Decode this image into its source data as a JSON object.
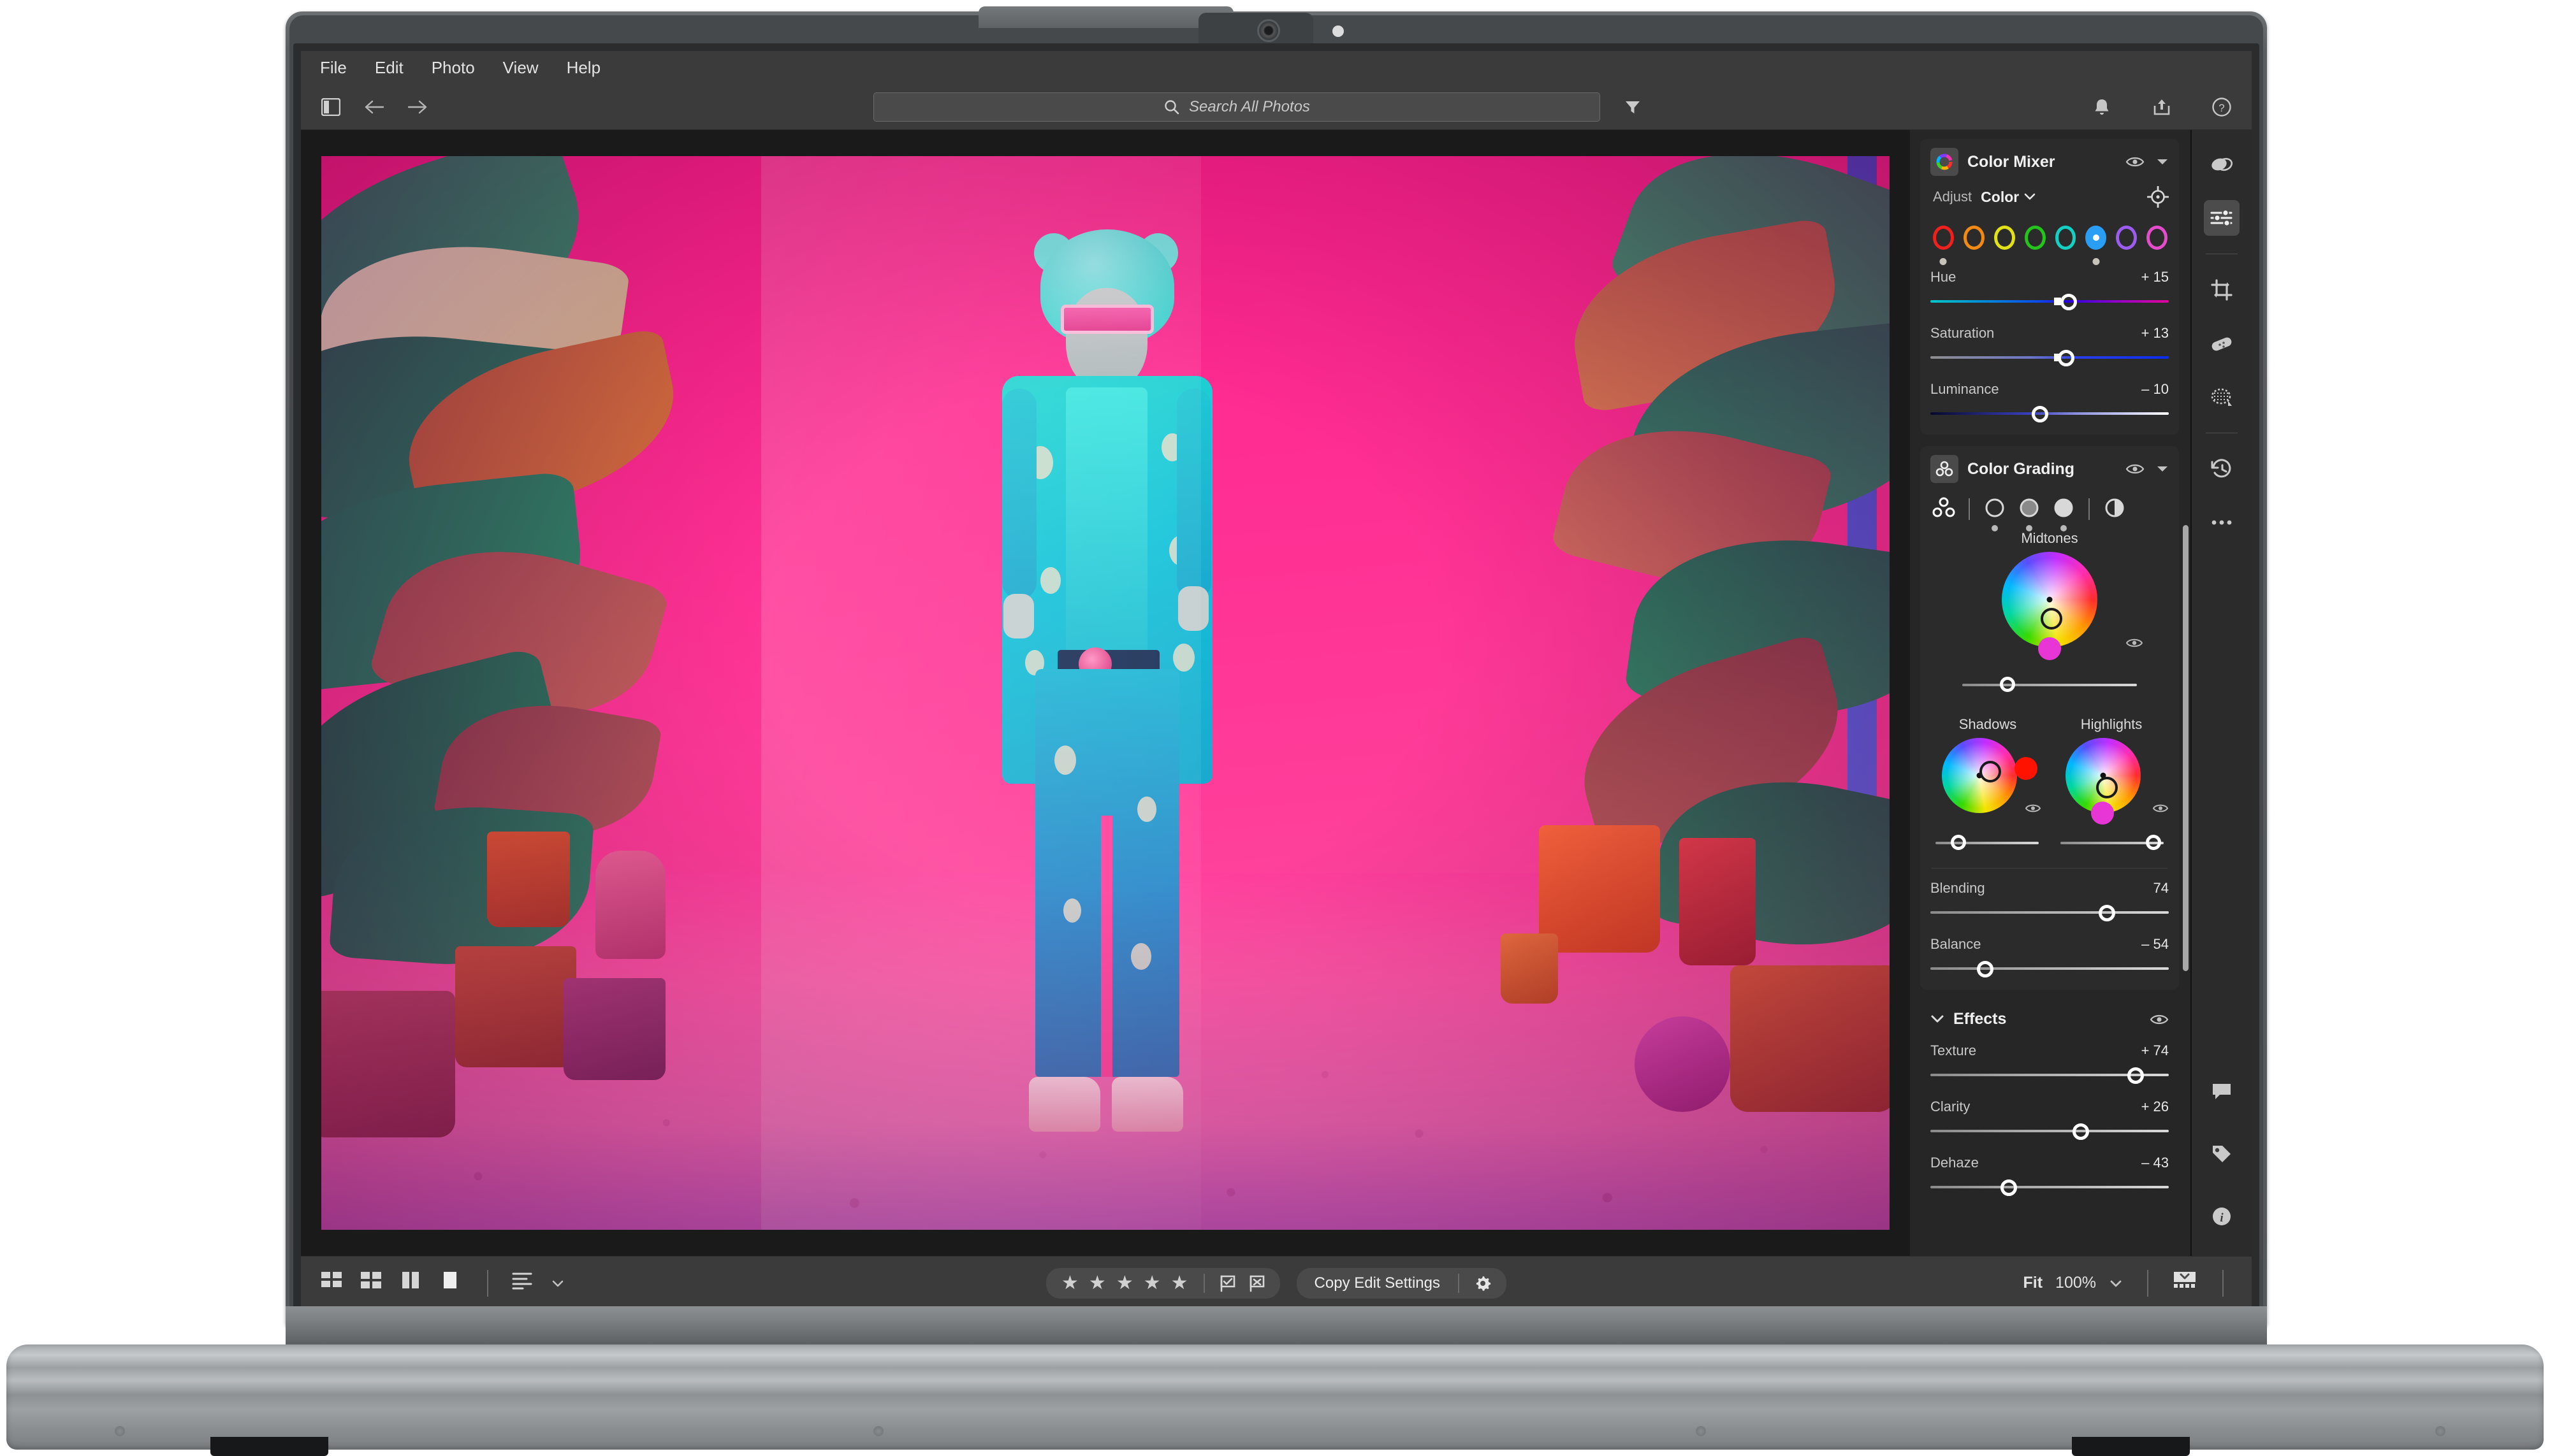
{
  "app": {
    "menubar": [
      {
        "label": "File"
      },
      {
        "label": "Edit"
      },
      {
        "label": "Photo"
      },
      {
        "label": "View"
      },
      {
        "label": "Help"
      }
    ]
  },
  "toolbar": {
    "panel_toggle_icon": "sidebar-panel-icon",
    "back_icon": "arrow-left-icon",
    "forward_icon": "arrow-right-icon",
    "search": {
      "icon": "search-icon",
      "placeholder": "Search All Photos",
      "value": ""
    },
    "filter_icon": "filter-funnel-icon",
    "notifications_icon": "bell-icon",
    "share_icon": "share-upload-icon",
    "help_icon": "help-circle-icon"
  },
  "color_mixer": {
    "title": "Color Mixer",
    "icon": "color-wheel-icon",
    "visibility_icon": "eye-icon",
    "collapse_icon": "chevron-down-icon",
    "adjust_label": "Adjust",
    "adjust_value": "Color",
    "adjust_chevron": "chevron-down-icon",
    "target_icon": "target-adjust-icon",
    "swatches": [
      {
        "name": "red",
        "color": "#f0201c",
        "selected": false,
        "marked": true
      },
      {
        "name": "orange",
        "color": "#f08a14",
        "selected": false,
        "marked": false
      },
      {
        "name": "yellow",
        "color": "#e2e016",
        "selected": false,
        "marked": false
      },
      {
        "name": "green",
        "color": "#25c41c",
        "selected": false,
        "marked": false
      },
      {
        "name": "aqua",
        "color": "#14cfc4",
        "selected": false,
        "marked": false
      },
      {
        "name": "blue",
        "color": "#2a9df4",
        "selected": true,
        "marked": true
      },
      {
        "name": "purple",
        "color": "#9d5cf0",
        "selected": false,
        "marked": false
      },
      {
        "name": "magenta",
        "color": "#e44ccb",
        "selected": false,
        "marked": false
      }
    ],
    "sliders": [
      {
        "label": "Hue",
        "value": "+ 15",
        "pos": 58,
        "track": "hue"
      },
      {
        "label": "Saturation",
        "value": "+ 13",
        "pos": 57,
        "track": "sat"
      },
      {
        "label": "Luminance",
        "value": "– 10",
        "pos": 46,
        "track": "lum"
      }
    ]
  },
  "color_grading": {
    "title": "Color Grading",
    "icon": "three-circles-icon",
    "visibility_icon": "eye-icon",
    "collapse_icon": "chevron-down-icon",
    "modes": [
      {
        "name": "all-wheels-mode",
        "icon": "three-circles-icon",
        "selected": true
      },
      {
        "name": "shadows-mode",
        "icon": "circle-outline-icon",
        "selected": false
      },
      {
        "name": "midtones-mode",
        "icon": "circle-half-icon",
        "selected": false
      },
      {
        "name": "highlights-mode",
        "icon": "circle-filled-icon",
        "selected": false
      },
      {
        "name": "global-mode",
        "icon": "contrast-circle-icon",
        "selected": false
      }
    ],
    "midtones": {
      "label": "Midtones",
      "hue_dot_color": "#e836d6",
      "luminance_pos": 26,
      "eye_icon": "eye-icon"
    },
    "shadows": {
      "label": "Shadows",
      "hue_dot_color": "#ff1200",
      "luminance_pos": 22,
      "eye_icon": "eye-icon"
    },
    "highlights": {
      "label": "Highlights",
      "hue_dot_color": "#e836d6",
      "luminance_pos": 88,
      "eye_icon": "eye-icon"
    },
    "sliders": [
      {
        "label": "Blending",
        "value": "74",
        "pos": 74
      },
      {
        "label": "Balance",
        "value": "– 54",
        "pos": 23
      }
    ]
  },
  "effects": {
    "title": "Effects",
    "collapse_icon": "chevron-down-icon",
    "visibility_icon": "eye-icon",
    "sliders": [
      {
        "label": "Texture",
        "value": "+ 74",
        "pos": 86
      },
      {
        "label": "Clarity",
        "value": "+ 26",
        "pos": 63
      },
      {
        "label": "Dehaze",
        "value": "– 43",
        "pos": 33
      }
    ]
  },
  "rail": {
    "items": [
      {
        "name": "presets-icon",
        "active": false
      },
      {
        "name": "edit-sliders-icon",
        "active": true
      },
      {
        "name": "crop-rotate-icon",
        "active": false
      },
      {
        "name": "healing-brush-icon",
        "active": false
      },
      {
        "name": "masking-icon",
        "active": false
      },
      {
        "name": "history-icon",
        "active": false
      },
      {
        "name": "more-options-icon",
        "active": false
      }
    ],
    "bottom_items": [
      {
        "name": "comment-icon"
      },
      {
        "name": "tag-icon"
      },
      {
        "name": "info-icon"
      }
    ]
  },
  "bottombar": {
    "view_modes": [
      {
        "name": "grid-view-icon"
      },
      {
        "name": "compact-grid-view-icon"
      },
      {
        "name": "compare-view-icon"
      },
      {
        "name": "single-photo-view-icon"
      }
    ],
    "sort_icon": "sort-icon",
    "sort_chevron": "chevron-down-icon",
    "rating": {
      "stars": 5,
      "filled": 0,
      "star_glyph": "★"
    },
    "flag_pick_icon": "flag-pick-icon",
    "flag_reject_icon": "flag-reject-icon",
    "copy_button_label": "Copy Edit Settings",
    "copy_settings_gear_icon": "gear-icon",
    "zoom_fit_label": "Fit",
    "zoom_level": "100%",
    "zoom_chevron": "chevron-down-icon",
    "filmstrip_toggle_icon": "filmstrip-toggle-icon"
  },
  "photo": {
    "description": "neon pink room with tropical plants and a figure in a teal patterned suit",
    "accent_pink": "#ff2f93",
    "accent_teal": "#1fc7d4"
  }
}
